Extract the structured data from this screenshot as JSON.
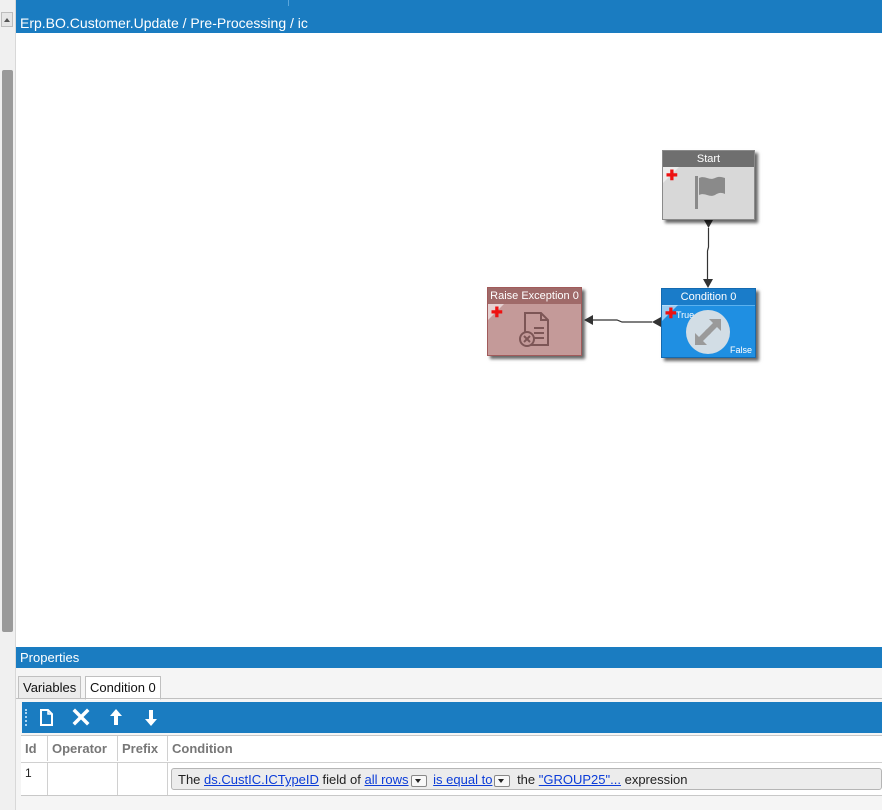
{
  "header": {
    "breadcrumb": "Erp.BO.Customer.Update / Pre-Processing / ic"
  },
  "canvas": {
    "nodes": {
      "start": {
        "title": "Start",
        "icon": "flag-icon"
      },
      "condition": {
        "title": "Condition 0",
        "true_label": "True",
        "false_label": "False",
        "icon": "condition-arrows-icon"
      },
      "raise": {
        "title": "Raise Exception 0",
        "icon": "document-error-icon"
      }
    }
  },
  "properties": {
    "title": "Properties",
    "tabs": [
      {
        "label": "Variables",
        "active": false
      },
      {
        "label": "Condition 0",
        "active": true
      }
    ],
    "toolbar": {
      "icons": [
        "new-document-icon",
        "delete-icon",
        "move-up-icon",
        "move-down-icon"
      ]
    },
    "grid": {
      "headers": {
        "id": "Id",
        "operator": "Operator",
        "prefix": "Prefix",
        "condition": "Condition"
      },
      "row": {
        "id": "1",
        "operator": "",
        "prefix": "",
        "condition": {
          "t1": "The",
          "field": "ds.CustIC.ICTypeID",
          "t2": "field of",
          "rows": "all rows",
          "comparison": "is equal to",
          "t3": "the",
          "value": "\"GROUP25\"...",
          "t4": "expression"
        }
      }
    }
  },
  "colors": {
    "accent": "#1a7cc1",
    "condition_node": "#1f8fe2",
    "raise_node": "#c49a99",
    "start_node": "#d8d8d8",
    "link": "#0b3cd8"
  }
}
